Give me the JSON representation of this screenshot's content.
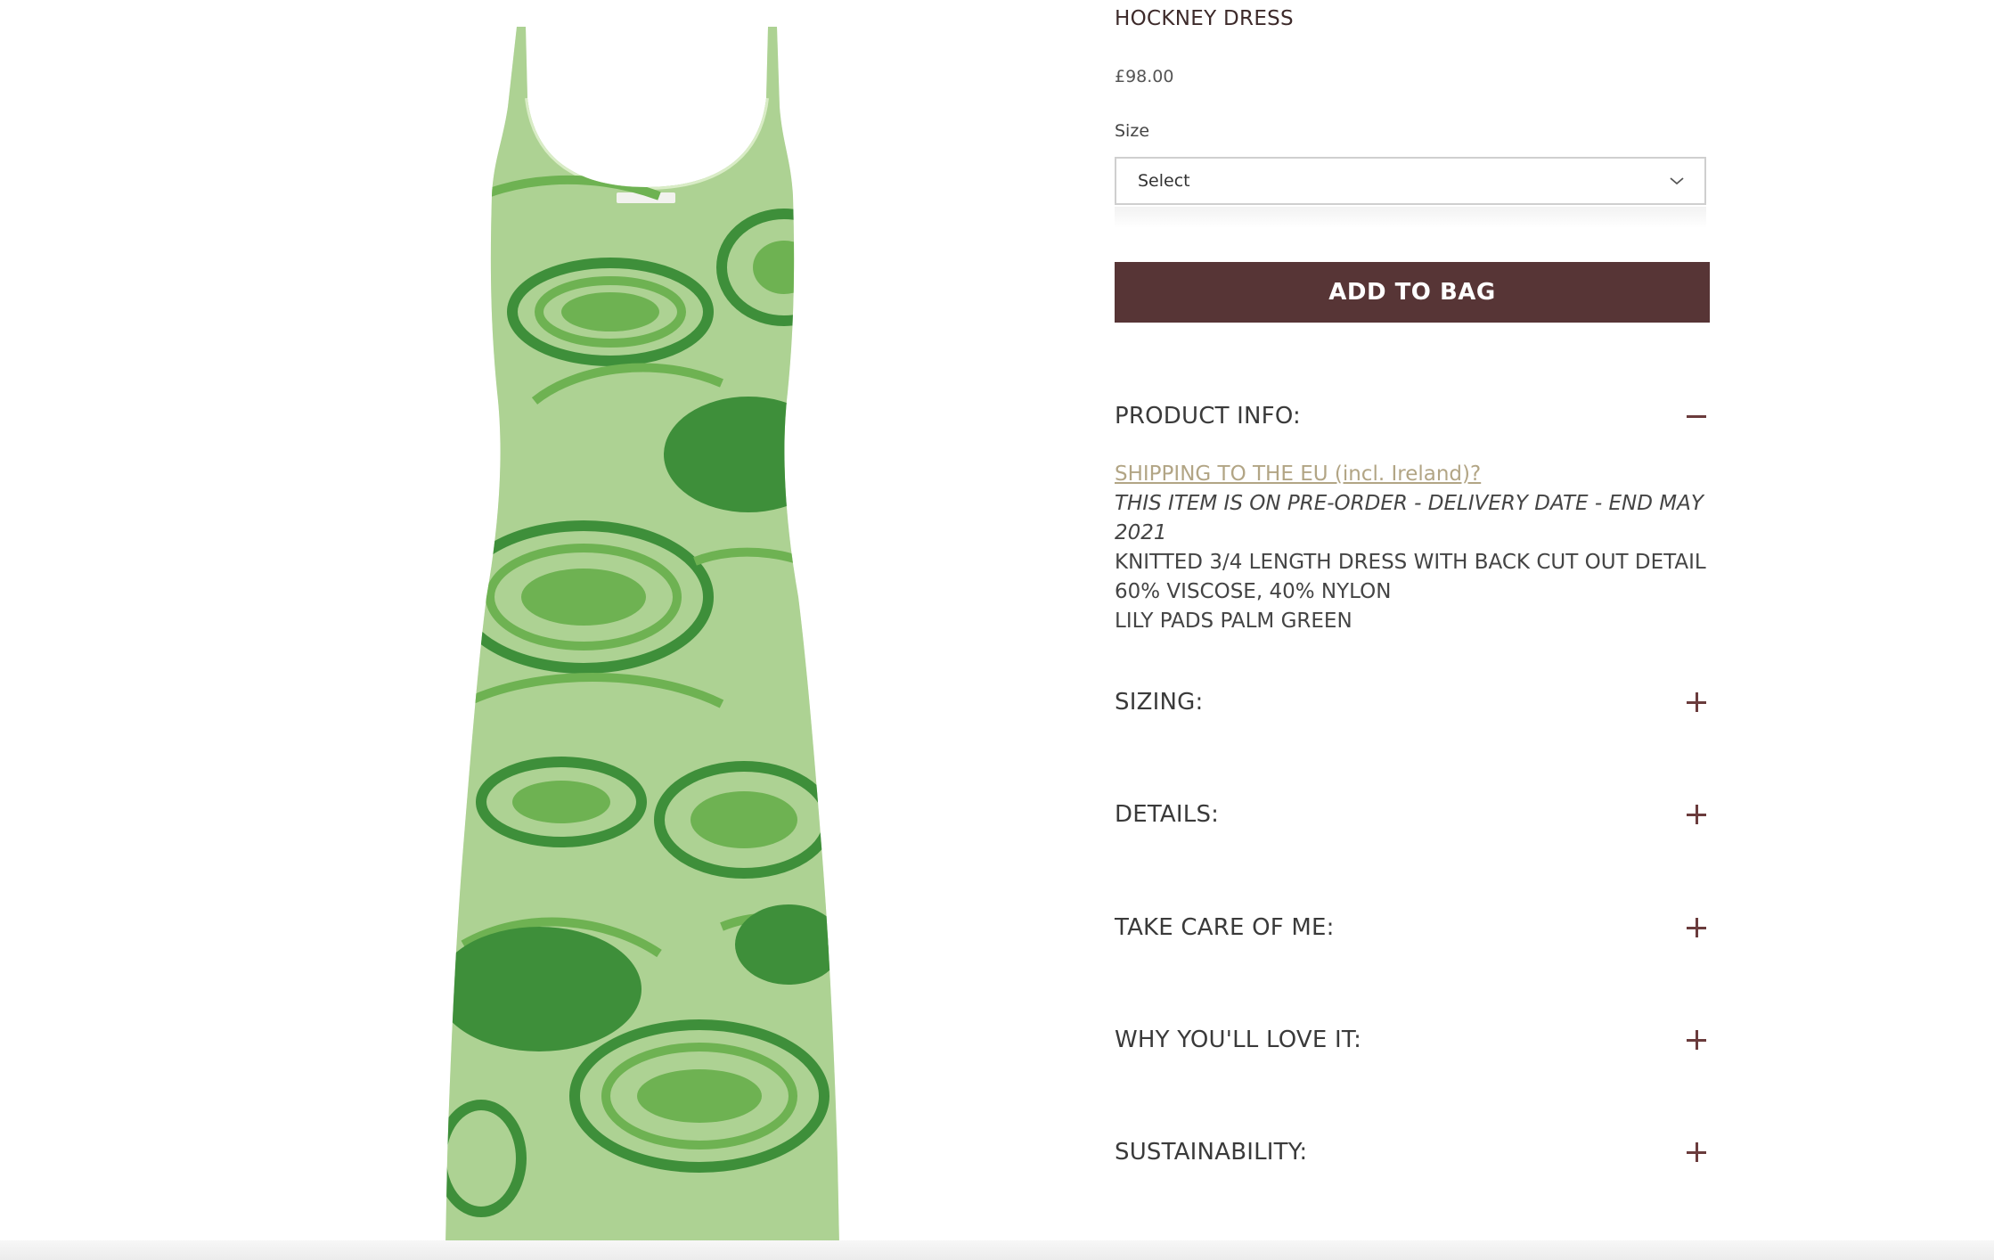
{
  "product": {
    "title": "HOCKNEY DRESS",
    "price": "£98.00",
    "image_label": "dress-image"
  },
  "size": {
    "label": "Size",
    "selected": "Select"
  },
  "actions": {
    "add_to_bag": "ADD TO BAG"
  },
  "accordion": {
    "product_info": {
      "title": "PRODUCT INFO:",
      "expanded": true,
      "shipping_link": "SHIPPING TO THE EU (incl. Ireland)?",
      "preorder_note": "THIS ITEM IS ON PRE-ORDER - DELIVERY DATE - END MAY 2021",
      "description": "KNITTED 3/4 LENGTH DRESS WITH BACK CUT OUT DETAIL",
      "composition": "60% VISCOSE, 40% NYLON",
      "colour": "LILY PADS PALM GREEN"
    },
    "sizing": {
      "title": "SIZING:",
      "expanded": false
    },
    "details": {
      "title": "DETAILS:",
      "expanded": false
    },
    "care": {
      "title": "TAKE CARE OF ME:",
      "expanded": false
    },
    "love": {
      "title": "WHY YOU'LL LOVE IT:",
      "expanded": false
    },
    "sustainability": {
      "title": "SUSTAINABILITY:",
      "expanded": false
    }
  },
  "colors": {
    "button": "#573536",
    "link": "#b2a585",
    "icon": "#6a3b3c",
    "dress_base": "#a8cf8e",
    "dress_dark": "#3e8f3a",
    "dress_mid": "#6eb252"
  },
  "icons": {
    "select_chevron": "chevron-down-icon",
    "collapse": "minus-icon",
    "expand": "plus-icon"
  }
}
